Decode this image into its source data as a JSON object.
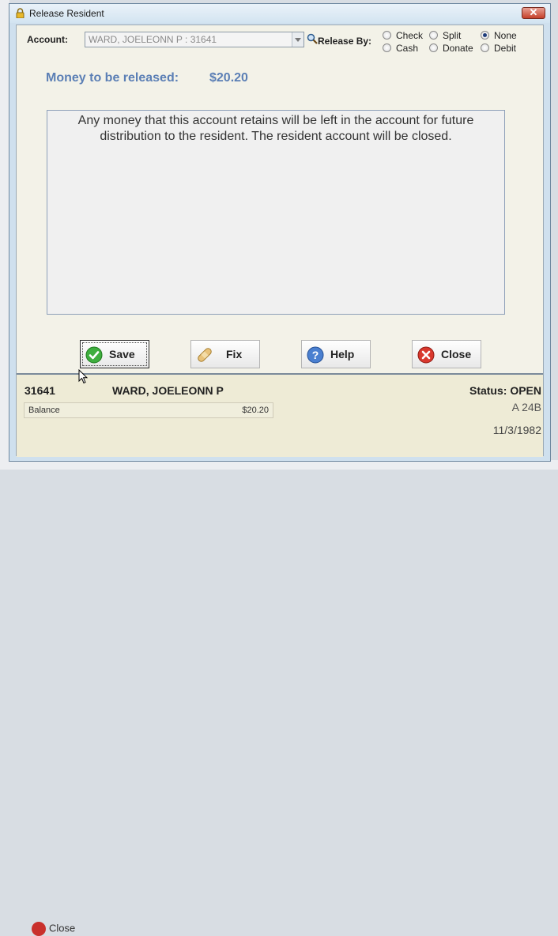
{
  "window": {
    "title": "Release Resident",
    "close_glyph": "✕"
  },
  "account": {
    "label": "Account:",
    "value": "WARD,  JOELEONN P : 31641"
  },
  "release_by": {
    "label": "Release By:",
    "options": [
      {
        "label": "Check",
        "checked": false
      },
      {
        "label": "Split",
        "checked": false
      },
      {
        "label": "None",
        "checked": true
      },
      {
        "label": "Cash",
        "checked": false
      },
      {
        "label": "Donate",
        "checked": false
      },
      {
        "label": "Debit",
        "checked": false
      }
    ]
  },
  "money": {
    "label": "Money to be released:",
    "value": "$20.20"
  },
  "message": "Any money that this account retains will be left in the account for future distribution to the resident.  The resident account will be closed.",
  "buttons": {
    "save": "Save",
    "fix": "Fix",
    "help": "Help",
    "close": "Close"
  },
  "resident": {
    "id": "31641",
    "name": "WARD,  JOELEONN P",
    "status": "Status: OPEN",
    "balance_label": "Balance",
    "balance_value": "$20.20",
    "location": "A 24B",
    "date": "11/3/1982"
  },
  "background": {
    "close_label": "Close"
  },
  "colors": {
    "accent_blue": "#5b7fb5",
    "title_close": "#c5402a",
    "panel_bg": "#f3f2e8"
  }
}
